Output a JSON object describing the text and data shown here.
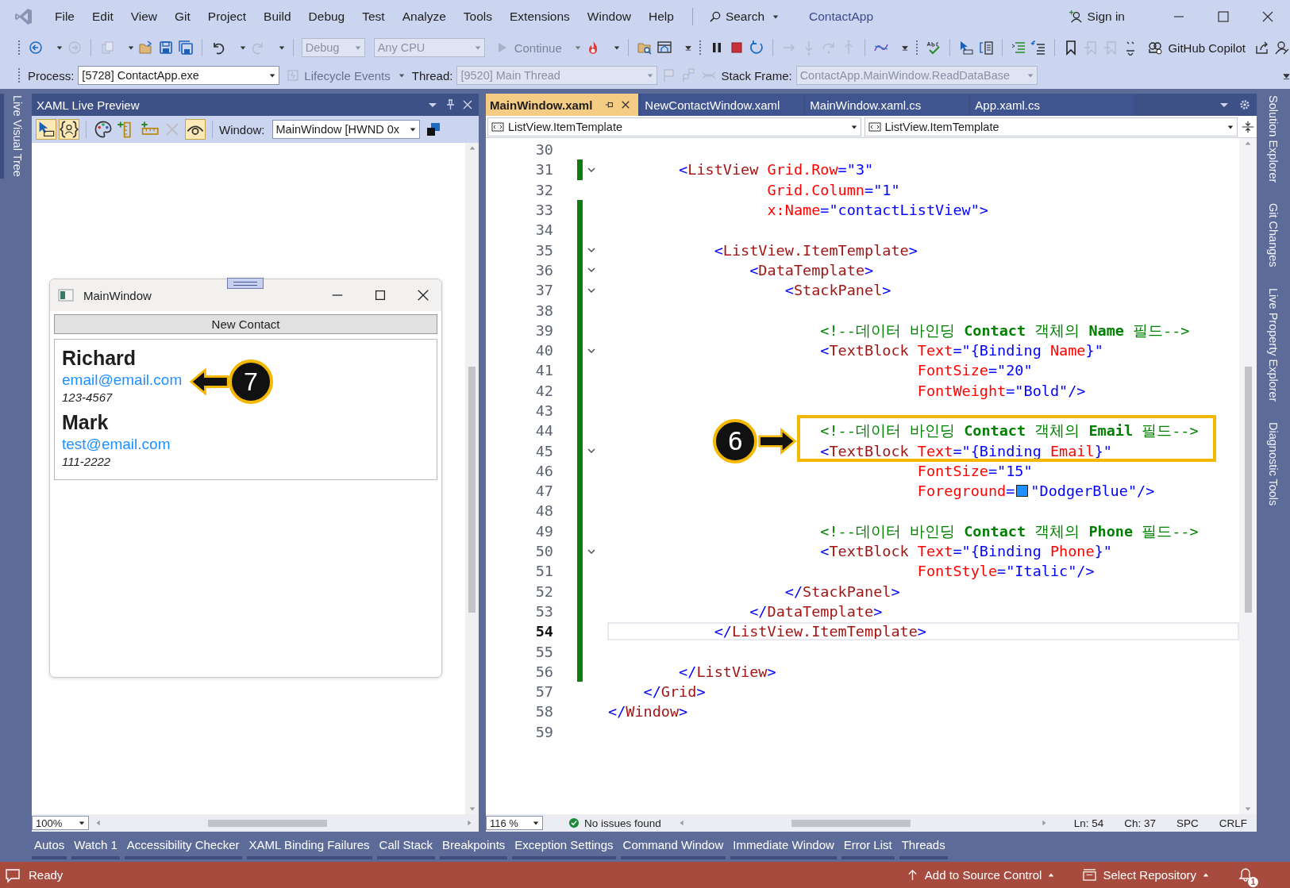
{
  "menu": [
    "File",
    "Edit",
    "View",
    "Git",
    "Project",
    "Build",
    "Debug",
    "Test",
    "Analyze",
    "Tools",
    "Extensions",
    "Window",
    "Help"
  ],
  "search": "Search",
  "solution_name": "ContactApp",
  "sign_in": "Sign in",
  "toolbar": {
    "configuration": "Debug",
    "platform": "Any CPU",
    "continue": "Continue",
    "copilot": "GitHub Copilot"
  },
  "debug_location": {
    "process_label": "Process:",
    "process": "[5728] ContactApp.exe",
    "lifecycle": "Lifecycle Events",
    "thread_label": "Thread:",
    "thread": "[9520] Main Thread",
    "stack_frame_label": "Stack Frame:",
    "stack_frame": "ContactApp.MainWindow.ReadDataBase"
  },
  "left_side_tabs": [
    {
      "label": "Live Visual Tree",
      "selected": true
    }
  ],
  "live_preview": {
    "title": "XAML Live Preview",
    "tools": [
      {
        "kind": "select",
        "on": true
      },
      {
        "kind": "binding",
        "on": true
      },
      {
        "kind": "palette",
        "on": false
      },
      {
        "kind": "ruler-vertical",
        "on": false
      },
      {
        "kind": "ruler-horizontal",
        "on": false
      },
      {
        "kind": "clear",
        "on": false
      },
      {
        "kind": "eye",
        "on": true
      }
    ],
    "window_label": "Window:",
    "window_value": "MainWindow [HWND 0x",
    "zoom": "100%",
    "app_window": {
      "title": "MainWindow",
      "button": "New Contact",
      "contacts": [
        {
          "name": "Richard",
          "email": "email@email.com",
          "phone": "123-4567",
          "callout": "7"
        },
        {
          "name": "Mark",
          "email": "test@email.com",
          "phone": "111-2222"
        }
      ]
    }
  },
  "editor": {
    "tabs": [
      {
        "label": "MainWindow.xaml",
        "selected": true
      },
      {
        "label": "NewContactWindow.xaml",
        "selected": false
      },
      {
        "label": "MainWindow.xaml.cs",
        "selected": false
      },
      {
        "label": "App.xaml.cs",
        "selected": false
      }
    ],
    "nav_left": "ListView.ItemTemplate",
    "nav_right": "ListView.ItemTemplate",
    "callout": "6",
    "lines": [
      {
        "number": "30"
      },
      {
        "number": "31",
        "changed": true,
        "fold": true,
        "tokens": [
          {
            "kind": "bracket",
            "text": "        <"
          },
          {
            "kind": "element",
            "text": "ListView"
          },
          {
            "kind": "attribute",
            "text": " Grid.Row"
          },
          {
            "kind": "value",
            "text": "=\"3\""
          }
        ]
      },
      {
        "number": "32",
        "tokens": [
          {
            "kind": "attribute",
            "text": "                  Grid.Column"
          },
          {
            "kind": "value",
            "text": "=\"1\""
          }
        ]
      },
      {
        "number": "33",
        "changed": true,
        "tokens": [
          {
            "kind": "attribute",
            "text": "                  x:Name"
          },
          {
            "kind": "value",
            "text": "=\"contactListView\">"
          }
        ]
      },
      {
        "number": "34",
        "changed": true
      },
      {
        "number": "35",
        "changed": true,
        "fold": true,
        "tokens": [
          {
            "kind": "bracket",
            "text": "            <"
          },
          {
            "kind": "element",
            "text": "ListView.ItemTemplate"
          },
          {
            "kind": "bracket",
            "text": ">"
          }
        ]
      },
      {
        "number": "36",
        "changed": true,
        "fold": true,
        "tokens": [
          {
            "kind": "bracket",
            "text": "                <"
          },
          {
            "kind": "element",
            "text": "DataTemplate"
          },
          {
            "kind": "bracket",
            "text": ">"
          }
        ]
      },
      {
        "number": "37",
        "changed": true,
        "fold": true,
        "tokens": [
          {
            "kind": "bracket",
            "text": "                    <"
          },
          {
            "kind": "element",
            "text": "StackPanel"
          },
          {
            "kind": "bracket",
            "text": ">"
          }
        ]
      },
      {
        "number": "38",
        "changed": true
      },
      {
        "number": "39",
        "changed": true,
        "tokens": [
          {
            "kind": "comment",
            "text": "                        <!--데이터 바인딩 "
          },
          {
            "kind": "comment-keyword",
            "text": "Contact"
          },
          {
            "kind": "comment",
            "text": " 객체의 "
          },
          {
            "kind": "comment-keyword",
            "text": "Name"
          },
          {
            "kind": "comment",
            "text": " 필드-->"
          }
        ]
      },
      {
        "number": "40",
        "changed": true,
        "fold": true,
        "tokens": [
          {
            "kind": "bracket",
            "text": "                        <"
          },
          {
            "kind": "element",
            "text": "TextBlock"
          },
          {
            "kind": "attribute",
            "text": " Text"
          },
          {
            "kind": "value",
            "text": "=\"{Binding"
          },
          {
            "kind": "attribute",
            "text": " Name"
          },
          {
            "kind": "value",
            "text": "}\""
          }
        ]
      },
      {
        "number": "41",
        "changed": true,
        "tokens": [
          {
            "kind": "attribute",
            "text": "                                   FontSize"
          },
          {
            "kind": "value",
            "text": "=\"20\""
          }
        ]
      },
      {
        "number": "42",
        "changed": true,
        "tokens": [
          {
            "kind": "attribute",
            "text": "                                   FontWeight"
          },
          {
            "kind": "value",
            "text": "=\"Bold\"/>"
          }
        ]
      },
      {
        "number": "43",
        "changed": true
      },
      {
        "number": "44",
        "changed": true,
        "highlight": true,
        "tokens": [
          {
            "kind": "comment",
            "text": "                        <!--데이터 바인딩 "
          },
          {
            "kind": "comment-keyword",
            "text": "Contact"
          },
          {
            "kind": "comment",
            "text": " 객체의 "
          },
          {
            "kind": "comment-keyword",
            "text": "Email"
          },
          {
            "kind": "comment",
            "text": " 필드-->"
          }
        ]
      },
      {
        "number": "45",
        "changed": true,
        "fold": true,
        "highlight": true,
        "tokens": [
          {
            "kind": "bracket",
            "text": "                        <"
          },
          {
            "kind": "element",
            "text": "TextBlock"
          },
          {
            "kind": "attribute",
            "text": " Text"
          },
          {
            "kind": "value",
            "text": "=\"{Binding"
          },
          {
            "kind": "attribute",
            "text": " Email"
          },
          {
            "kind": "value",
            "text": "}\""
          }
        ]
      },
      {
        "number": "46",
        "changed": true,
        "tokens": [
          {
            "kind": "attribute",
            "text": "                                   FontSize"
          },
          {
            "kind": "value",
            "text": "=\"15\""
          }
        ]
      },
      {
        "number": "47",
        "changed": true,
        "tokens": [
          {
            "kind": "attribute",
            "text": "                                   Foreground"
          },
          {
            "kind": "value",
            "text": "="
          },
          {
            "kind": "swatch",
            "color": "#1e90ff"
          },
          {
            "kind": "value",
            "text": "\"DodgerBlue\"/>"
          }
        ]
      },
      {
        "number": "48",
        "changed": true
      },
      {
        "number": "49",
        "changed": true,
        "tokens": [
          {
            "kind": "comment",
            "text": "                        <!--데이터 바인딩 "
          },
          {
            "kind": "comment-keyword",
            "text": "Contact"
          },
          {
            "kind": "comment",
            "text": " 객체의 "
          },
          {
            "kind": "comment-keyword",
            "text": "Phone"
          },
          {
            "kind": "comment",
            "text": " 필드-->"
          }
        ]
      },
      {
        "number": "50",
        "changed": true,
        "fold": true,
        "tokens": [
          {
            "kind": "bracket",
            "text": "                        <"
          },
          {
            "kind": "element",
            "text": "TextBlock"
          },
          {
            "kind": "attribute",
            "text": " Text"
          },
          {
            "kind": "value",
            "text": "=\"{Binding"
          },
          {
            "kind": "attribute",
            "text": " Phone"
          },
          {
            "kind": "value",
            "text": "}\""
          }
        ]
      },
      {
        "number": "51",
        "changed": true,
        "tokens": [
          {
            "kind": "attribute",
            "text": "                                   FontStyle"
          },
          {
            "kind": "value",
            "text": "=\"Italic\"/>"
          }
        ]
      },
      {
        "number": "52",
        "changed": true,
        "tokens": [
          {
            "kind": "bracket",
            "text": "                    </"
          },
          {
            "kind": "element",
            "text": "StackPanel"
          },
          {
            "kind": "bracket",
            "text": ">"
          }
        ]
      },
      {
        "number": "53",
        "changed": true,
        "tokens": [
          {
            "kind": "bracket",
            "text": "                </"
          },
          {
            "kind": "element",
            "text": "DataTemplate"
          },
          {
            "kind": "bracket",
            "text": ">"
          }
        ]
      },
      {
        "number": "54",
        "changed": true,
        "current": true,
        "tokens": [
          {
            "kind": "bracket",
            "text": "            </"
          },
          {
            "kind": "element",
            "text": "ListView.ItemTemplate"
          },
          {
            "kind": "bracket",
            "text": ">"
          }
        ]
      },
      {
        "number": "55",
        "changed": true
      },
      {
        "number": "56",
        "changed": true,
        "tokens": [
          {
            "kind": "bracket",
            "text": "        </"
          },
          {
            "kind": "element",
            "text": "ListView"
          },
          {
            "kind": "bracket",
            "text": ">"
          }
        ]
      },
      {
        "number": "57",
        "tokens": [
          {
            "kind": "bracket",
            "text": "    </"
          },
          {
            "kind": "element",
            "text": "Grid"
          },
          {
            "kind": "bracket",
            "text": ">"
          }
        ]
      },
      {
        "number": "58",
        "tokens": [
          {
            "kind": "bracket",
            "text": "</"
          },
          {
            "kind": "element",
            "text": "Window"
          },
          {
            "kind": "bracket",
            "text": ">"
          }
        ]
      },
      {
        "number": "59"
      }
    ],
    "zoom": "116 %",
    "issues": "No issues found",
    "line": "Ln: 54",
    "column": "Ch: 37",
    "spacing": "SPC",
    "line_ending": "CRLF"
  },
  "right_side_tabs": [
    {
      "label": "Solution Explorer",
      "selected": false
    },
    {
      "label": "Git Changes",
      "selected": false
    },
    {
      "label": "Live Property Explorer",
      "selected": false
    },
    {
      "label": "Diagnostic Tools",
      "selected": false
    }
  ],
  "bottom_tabs": [
    "Autos",
    "Watch 1",
    "Accessibility Checker",
    "XAML Binding Failures",
    "Call Stack",
    "Breakpoints",
    "Exception Settings",
    "Command Window",
    "Immediate Window",
    "Error List",
    "Threads"
  ],
  "status": {
    "text": "Ready",
    "source_control": "Add to Source Control",
    "repository": "Select Repository",
    "notifications": "1"
  }
}
